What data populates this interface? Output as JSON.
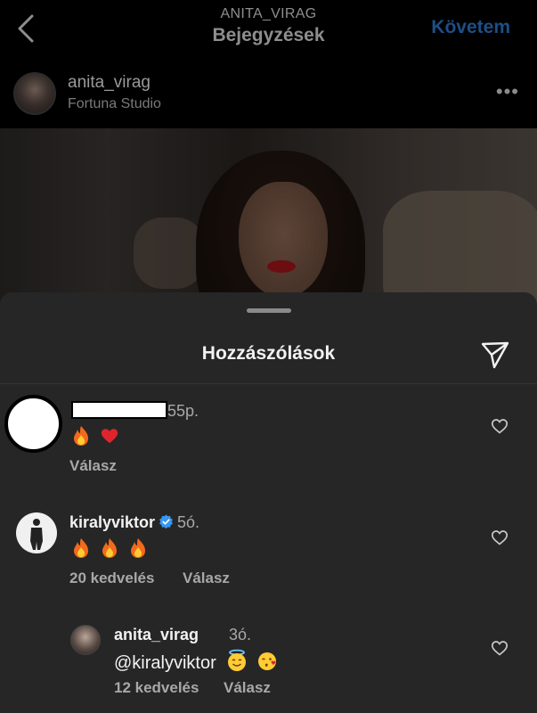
{
  "header": {
    "account_label": "ANITA_VIRAG",
    "title": "Bejegyzések",
    "follow_label": "Követem"
  },
  "post": {
    "username": "anita_virag",
    "location": "Fortuna Studio",
    "more_label": "•••"
  },
  "comments_sheet": {
    "title": "Hozzászólások",
    "comments": [
      {
        "username": "",
        "time": "55p.",
        "emojis": [
          "fire",
          "heart"
        ],
        "likes": "",
        "reply_label": "Válasz"
      },
      {
        "username": "kiralyviktor",
        "verified": true,
        "time": "5ó.",
        "emojis": [
          "fire",
          "fire",
          "fire"
        ],
        "likes": "20 kedvelés",
        "reply_label": "Válasz"
      },
      {
        "username": "anita_virag",
        "time": "3ó.",
        "text": "@kiralyviktor",
        "emojis": [
          "smiling-face-with-halo",
          "face-blowing-kiss"
        ],
        "likes": "12 kedvelés",
        "reply_label": "Válasz"
      }
    ]
  },
  "colors": {
    "background": "#000000",
    "sheet": "#262626",
    "follow_accent": "#1c4f86",
    "verified": "#3897f0"
  }
}
